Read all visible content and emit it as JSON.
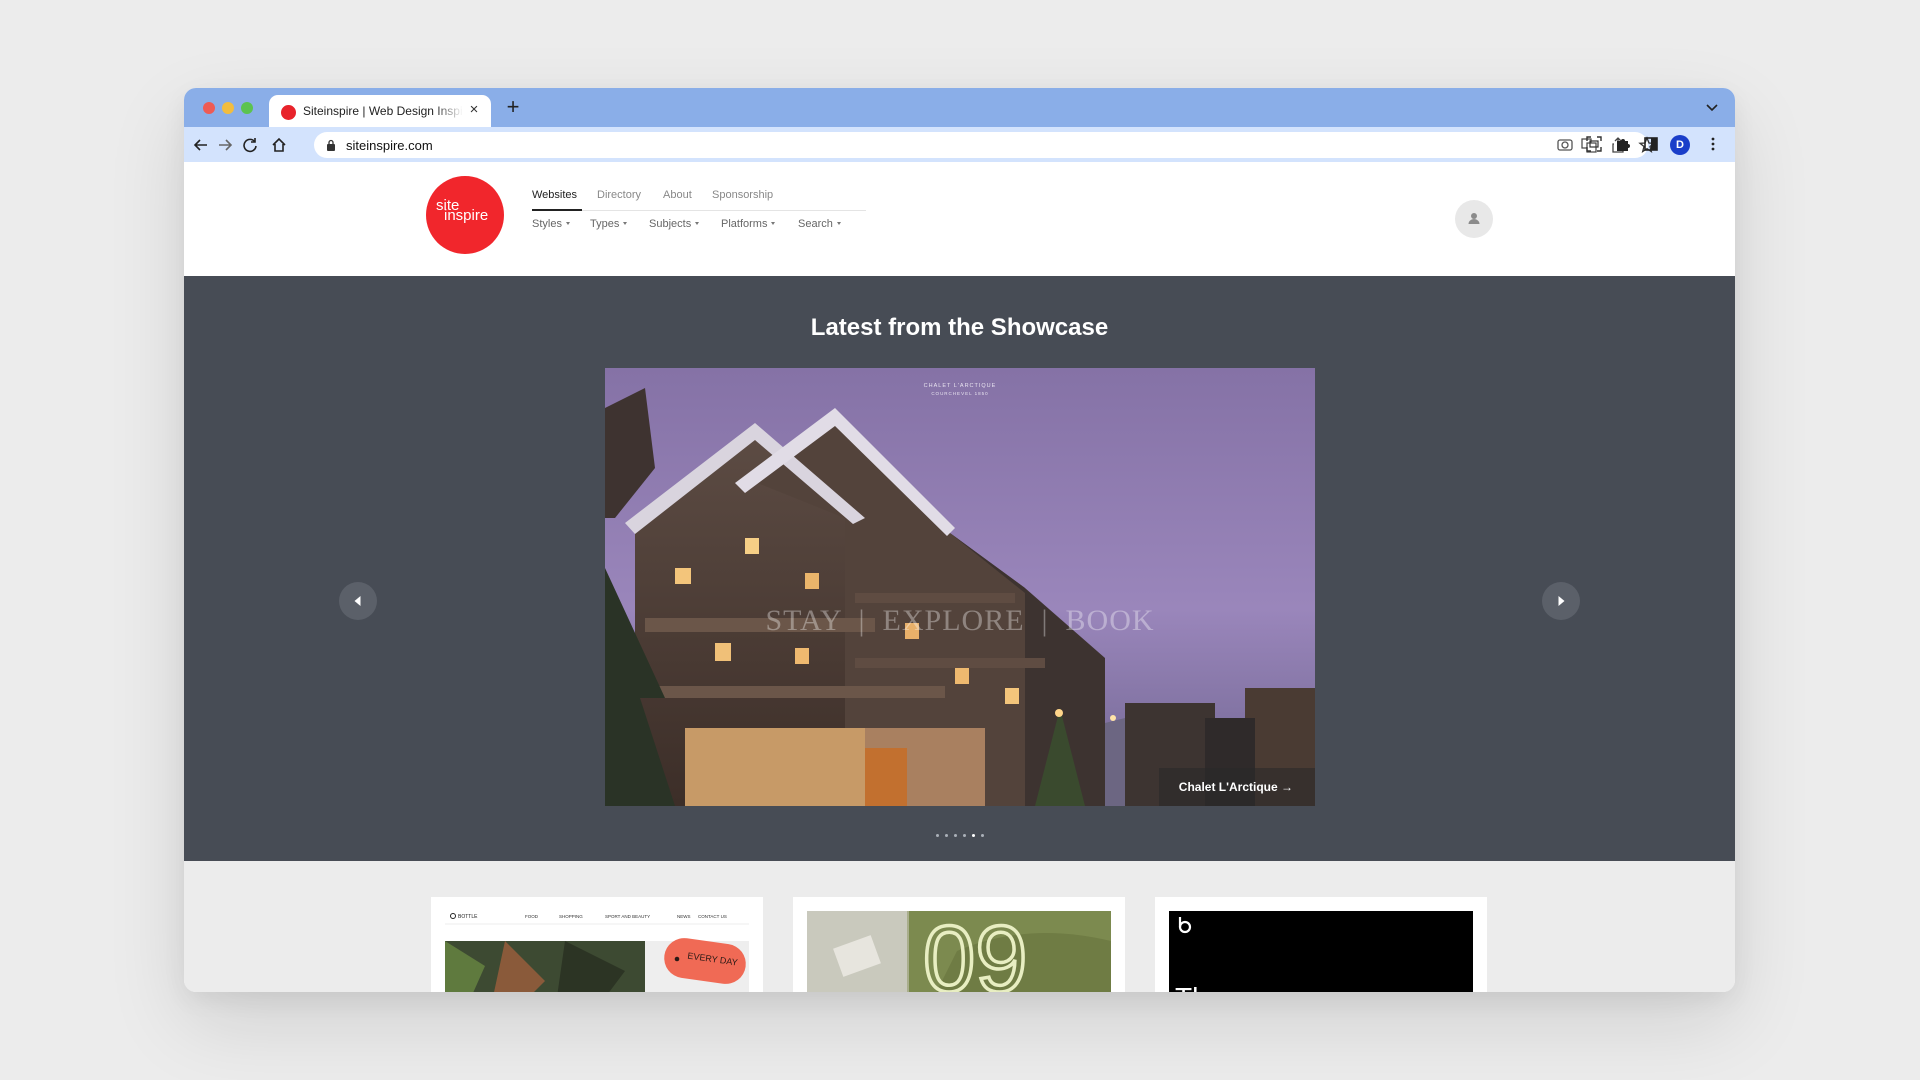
{
  "browser": {
    "tab_title": "Siteinspire | Web Design Inspiration",
    "new_tab_icon": "plus-icon",
    "url": "siteinspire.com",
    "profile_initial": "D"
  },
  "site": {
    "logo_line1": "site",
    "logo_line2": "inspire",
    "primary_nav": [
      "Websites",
      "Directory",
      "About",
      "Sponsorship"
    ],
    "secondary_nav": [
      "Styles",
      "Types",
      "Subjects",
      "Platforms",
      "Search"
    ]
  },
  "showcase": {
    "title": "Latest from the Showcase",
    "slide_brand_line1": "CHALET L'ARCTIQUE",
    "slide_brand_line2": "COURCHEVEL 1850",
    "slide_menu": "STAY  |  EXPLORE  |  BOOK",
    "slide_caption": "Chalet L'Arctique →",
    "dot_count": 6,
    "active_dot": 4
  },
  "cards": {
    "card1": {
      "brand": "BOTTLE",
      "nav": [
        "FOOD",
        "SHOPPING",
        "SPORT AND BEAUTY",
        "NEWS",
        "CONTACT US"
      ],
      "badge": "EVERY DAY"
    },
    "card2": {
      "number": "09"
    },
    "card3": {
      "text": "The"
    }
  },
  "colors": {
    "tabstrip": "#8aaee8",
    "toolbar": "#d3e3fd",
    "brand_red": "#f1262c",
    "showcase_bg": "#474c55"
  }
}
